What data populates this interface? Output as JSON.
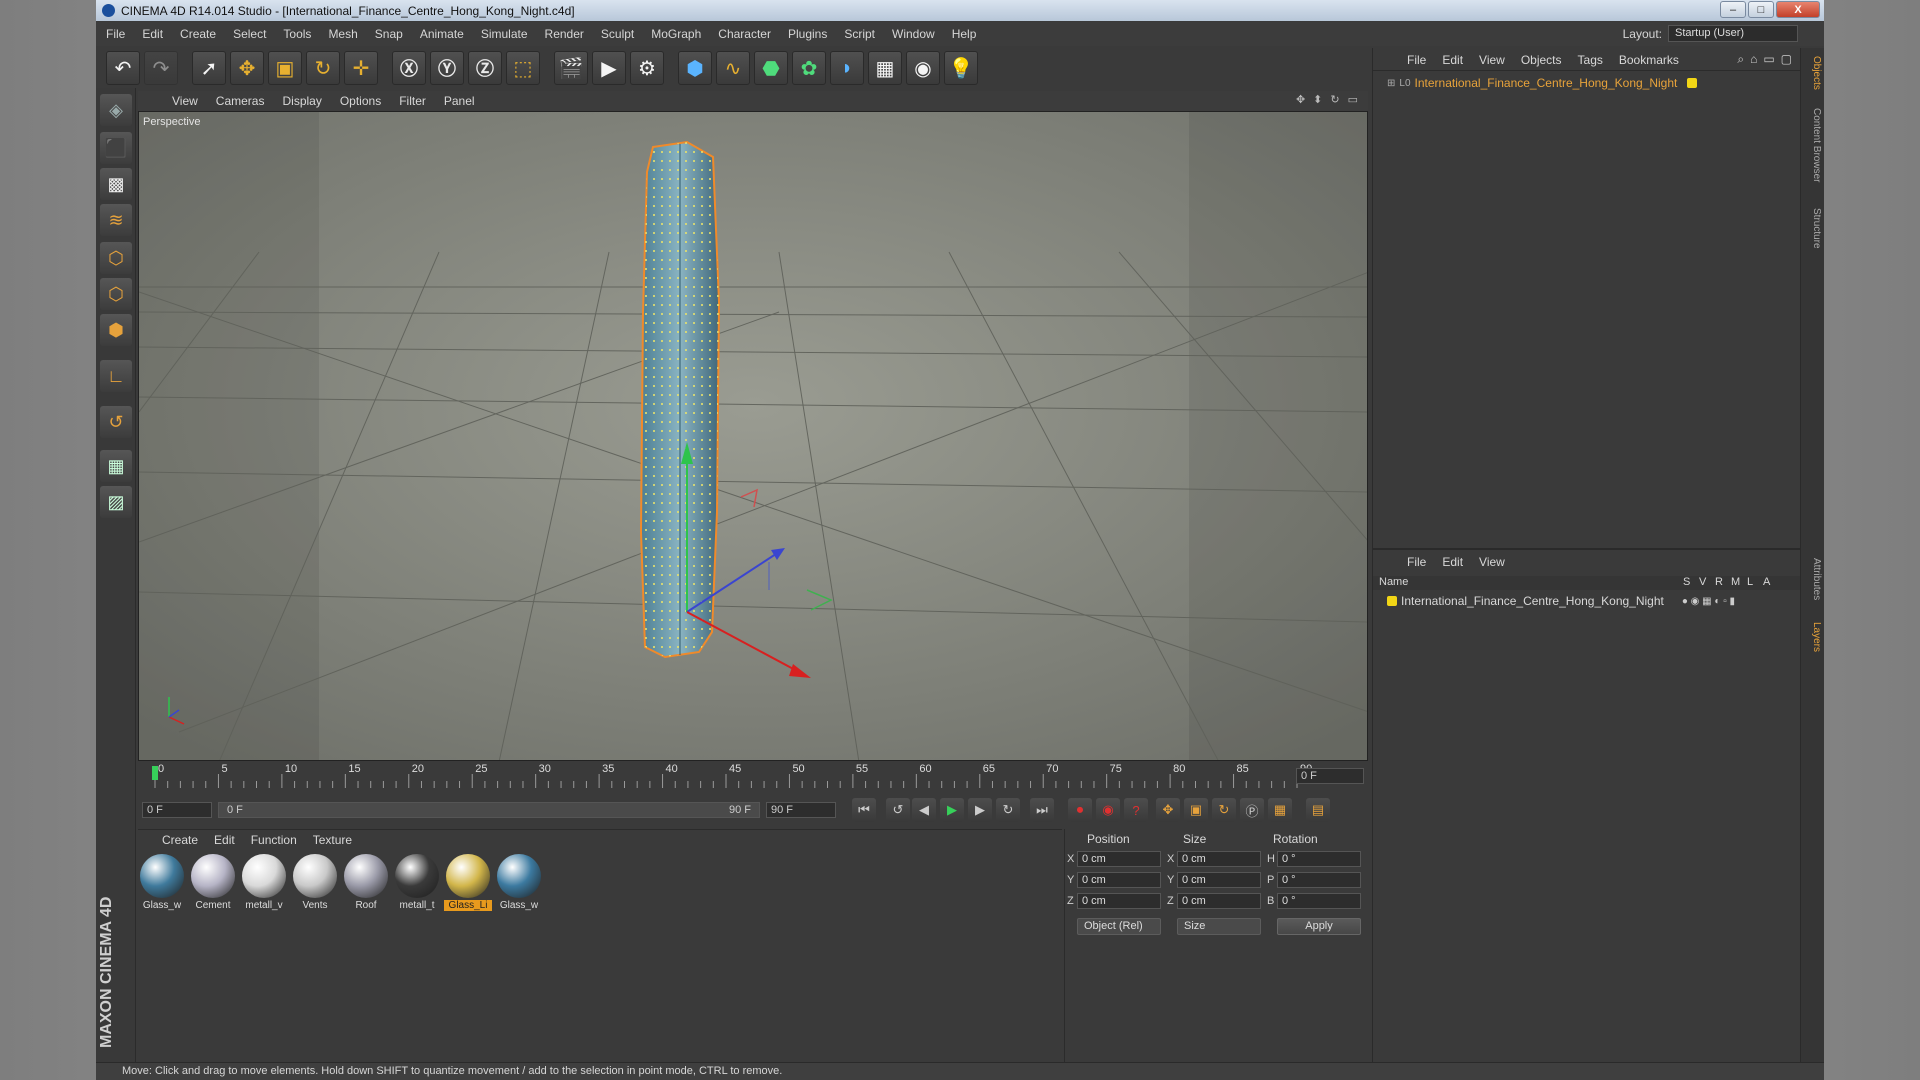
{
  "window": {
    "title": "CINEMA 4D R14.014 Studio - [International_Finance_Centre_Hong_Kong_Night.c4d]",
    "controls": [
      "–",
      "□",
      "X"
    ]
  },
  "menubar": {
    "items": [
      "File",
      "Edit",
      "Create",
      "Select",
      "Tools",
      "Mesh",
      "Snap",
      "Animate",
      "Simulate",
      "Render",
      "Sculpt",
      "MoGraph",
      "Character",
      "Plugins",
      "Script",
      "Window",
      "Help"
    ],
    "layout_label": "Layout:",
    "layout_value": "Startup (User)"
  },
  "viewport": {
    "menu": [
      "View",
      "Cameras",
      "Display",
      "Options",
      "Filter",
      "Panel"
    ],
    "label": "Perspective",
    "building_color": "#5d8fa0",
    "selection_color": "#f08a2a"
  },
  "timeline": {
    "ticks": [
      "0",
      "5",
      "10",
      "15",
      "20",
      "25",
      "30",
      "35",
      "40",
      "45",
      "50",
      "55",
      "60",
      "65",
      "70",
      "75",
      "80",
      "85",
      "90"
    ],
    "current_frame": "0 F",
    "start_frame": "0 F",
    "range_start": "0 F",
    "range_end": "90 F",
    "end_frame": "90 F"
  },
  "materials": {
    "menu": [
      "Create",
      "Edit",
      "Function",
      "Texture"
    ],
    "items": [
      {
        "name": "Glass_w",
        "color": "#3f7a9c"
      },
      {
        "name": "Cement",
        "color": "#b6b4c6"
      },
      {
        "name": "metall_v",
        "color": "#d9d9d9"
      },
      {
        "name": "Vents",
        "color": "#c9c9c9"
      },
      {
        "name": "Roof",
        "color": "#9a9aa8"
      },
      {
        "name": "metall_t",
        "color": "#3a3a3a"
      },
      {
        "name": "Glass_Li",
        "color": "#d2b64a"
      },
      {
        "name": "Glass_w",
        "color": "#3c7aa0"
      }
    ],
    "selected_index": 6
  },
  "coordinates": {
    "headers": [
      "Position",
      "Size",
      "Rotation"
    ],
    "rows": [
      {
        "pos_axis": "X",
        "pos": "0 cm",
        "size_axis": "X",
        "size": "0 cm",
        "rot_axis": "H",
        "rot": "0 °"
      },
      {
        "pos_axis": "Y",
        "pos": "0 cm",
        "size_axis": "Y",
        "size": "0 cm",
        "rot_axis": "P",
        "rot": "0 °"
      },
      {
        "pos_axis": "Z",
        "pos": "0 cm",
        "size_axis": "Z",
        "size": "0 cm",
        "rot_axis": "B",
        "rot": "0 °"
      }
    ],
    "mode": "Object (Rel)",
    "size_mode": "Size",
    "apply": "Apply"
  },
  "object_manager": {
    "menu": [
      "File",
      "Edit",
      "View",
      "Objects",
      "Tags",
      "Bookmarks"
    ],
    "object_name": "International_Finance_Centre_Hong_Kong_Night",
    "object_color": "#e8a33a"
  },
  "layer_manager": {
    "menu": [
      "File",
      "Edit",
      "View"
    ],
    "columns": [
      "Name",
      "S",
      "V",
      "R",
      "M",
      "L",
      "A"
    ],
    "layer_name": "International_Finance_Centre_Hong_Kong_Night"
  },
  "side_tabs": [
    "Objects",
    "Content Browser",
    "Structure",
    "Attributes",
    "Layers"
  ],
  "brand": "MAXON CINEMA 4D",
  "status": "Move: Click and drag to move elements. Hold down SHIFT to quantize movement / add to the selection in point mode, CTRL to remove."
}
